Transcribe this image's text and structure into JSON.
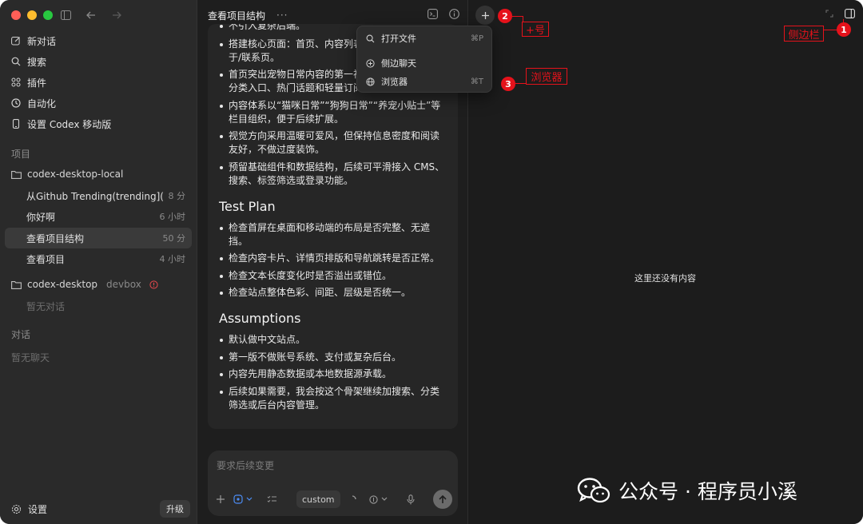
{
  "sidebar": {
    "nav": [
      {
        "label": "新对话",
        "icon": "edit-icon"
      },
      {
        "label": "搜索",
        "icon": "search-icon"
      },
      {
        "label": "插件",
        "icon": "grid-icon"
      },
      {
        "label": "自动化",
        "icon": "clock-icon"
      },
      {
        "label": "设置 Codex 移动版",
        "icon": "phone-icon"
      }
    ],
    "projects_label": "项目",
    "project1": {
      "name": "codex-desktop-local"
    },
    "threads": [
      {
        "title": "从Github Trending(trending](ht...",
        "time": "8 分"
      },
      {
        "title": "你好啊",
        "time": "6 小时"
      },
      {
        "title": "查看项目结构",
        "time": "50 分"
      },
      {
        "title": "查看项目",
        "time": "4 小时"
      }
    ],
    "project2": {
      "name": "codex-desktop",
      "tag": "devbox",
      "empty": "暂无对话"
    },
    "chats_label": "对话",
    "chats_empty": "暂无聊天",
    "settings_label": "设置",
    "upgrade_label": "升级"
  },
  "chat": {
    "title": "查看项目结构",
    "more": "···",
    "bullets_top": [
      "不引入复杂后端。",
      "搭建核心页面：首页、内容列表",
      "于/联系页。",
      "首页突出宠物日常内容的第一视",
      "分类入口、热门话题和轻量订阅/联系入口。",
      "内容体系以“猫咪日常”“狗狗日常”“养宠小贴士”等栏目组织，便于后续扩展。",
      "视觉方向采用温暖可爱风，但保持信息密度和阅读友好，不做过度装饰。",
      "预留基础组件和数据结构，后续可平滑接入 CMS、搜索、标签筛选或登录功能。"
    ],
    "test_plan_heading": "Test Plan",
    "test_plan": [
      "检查首屏在桌面和移动端的布局是否完整、无遮挡。",
      "检查内容卡片、详情页排版和导航跳转是否正常。",
      "检查文本长度变化时是否溢出或错位。",
      "检查站点整体色彩、间距、层级是否统一。"
    ],
    "assumptions_heading": "Assumptions",
    "assumptions": [
      "默认做中文站点。",
      "第一版不做账号系统、支付或复杂后台。",
      "内容先用静态数据或本地数据源承载。",
      "后续如果需要，我会按这个骨架继续加搜索、分类筛选或后台内容管理。"
    ],
    "composer": {
      "placeholder": "要求后续变更",
      "mode": "custom"
    }
  },
  "dropdown": {
    "items": [
      {
        "label": "打开文件",
        "shortcut": "⌘P",
        "icon": "search-icon"
      },
      {
        "label": "侧边聊天",
        "shortcut": "",
        "icon": "plus-circle-icon"
      },
      {
        "label": "浏览器",
        "shortcut": "⌘T",
        "icon": "globe-icon"
      }
    ]
  },
  "right": {
    "empty_text": "这里还没有内容"
  },
  "annotations": {
    "badge1": "1",
    "label1": "侧边栏",
    "badge2": "2",
    "label2": "+号",
    "badge3": "3",
    "label3": "浏览器",
    "color": "#e5121b"
  },
  "watermark": {
    "text": "公众号 · 程序员小溪"
  }
}
